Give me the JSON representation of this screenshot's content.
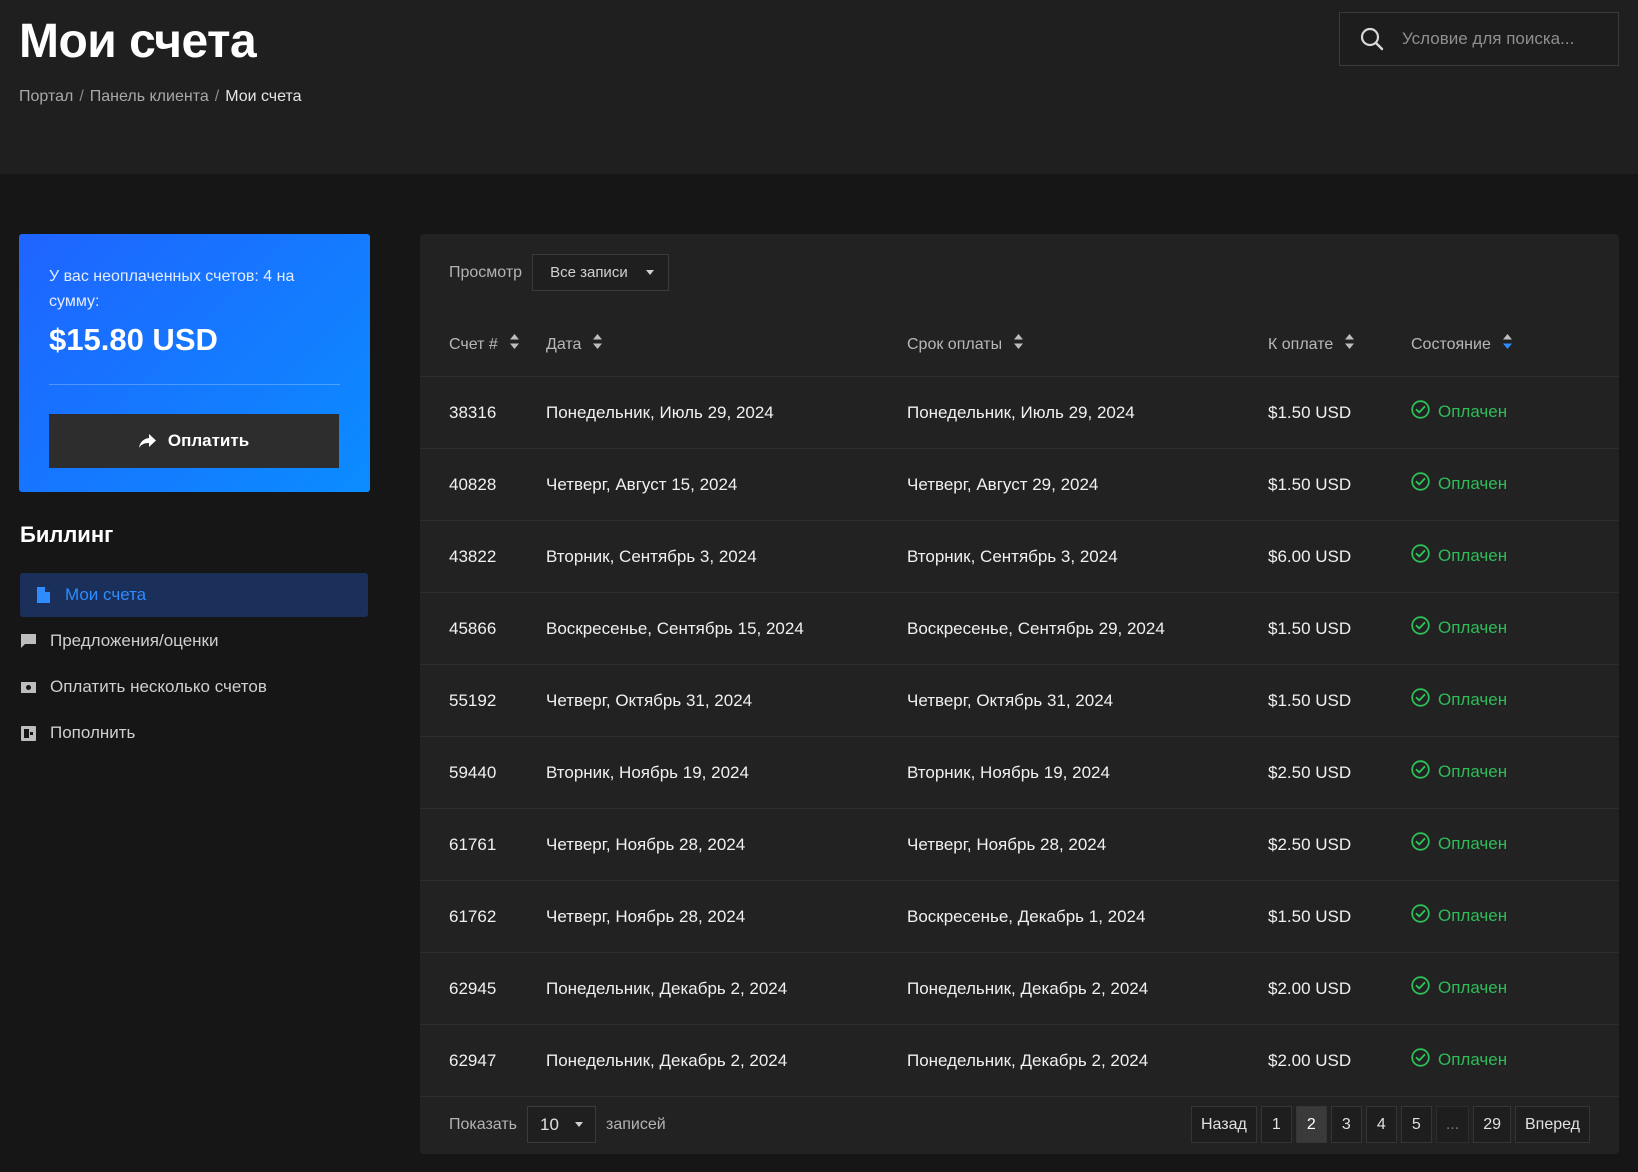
{
  "header": {
    "title": "Мои счета",
    "breadcrumb": [
      "Портал",
      "Панель клиента",
      "Мои счета"
    ],
    "search_placeholder": "Условие для поиска..."
  },
  "balance": {
    "text": "У вас неоплаченных счетов: 4 на сумму:",
    "amount": "$15.80 USD",
    "pay_label": "Оплатить"
  },
  "sidebar": {
    "title": "Биллинг",
    "items": [
      {
        "label": "Мои счета",
        "icon": "file-icon",
        "active": true
      },
      {
        "label": "Предложения/оценки",
        "icon": "comment-icon",
        "active": false
      },
      {
        "label": "Оплатить несколько счетов",
        "icon": "money-icon",
        "active": false
      },
      {
        "label": "Пополнить",
        "icon": "wallet-icon",
        "active": false
      }
    ]
  },
  "table": {
    "view_label": "Просмотр",
    "view_value": "Все записи",
    "columns": [
      "Счет #",
      "Дата",
      "Срок оплаты",
      "К оплате",
      "Состояние"
    ],
    "rows": [
      [
        "38316",
        "Понедельник, Июль 29, 2024",
        "Понедельник, Июль 29, 2024",
        "$1.50 USD",
        "Оплачен"
      ],
      [
        "40828",
        "Четверг, Август 15, 2024",
        "Четверг, Август 29, 2024",
        "$1.50 USD",
        "Оплачен"
      ],
      [
        "43822",
        "Вторник, Сентябрь 3, 2024",
        "Вторник, Сентябрь 3, 2024",
        "$6.00 USD",
        "Оплачен"
      ],
      [
        "45866",
        "Воскресенье, Сентябрь 15, 2024",
        "Воскресенье, Сентябрь 29, 2024",
        "$1.50 USD",
        "Оплачен"
      ],
      [
        "55192",
        "Четверг, Октябрь 31, 2024",
        "Четверг, Октябрь 31, 2024",
        "$1.50 USD",
        "Оплачен"
      ],
      [
        "59440",
        "Вторник, Ноябрь 19, 2024",
        "Вторник, Ноябрь 19, 2024",
        "$2.50 USD",
        "Оплачен"
      ],
      [
        "61761",
        "Четверг, Ноябрь 28, 2024",
        "Четверг, Ноябрь 28, 2024",
        "$2.50 USD",
        "Оплачен"
      ],
      [
        "61762",
        "Четверг, Ноябрь 28, 2024",
        "Воскресенье, Декабрь 1, 2024",
        "$1.50 USD",
        "Оплачен"
      ],
      [
        "62945",
        "Понедельник, Декабрь 2, 2024",
        "Понедельник, Декабрь 2, 2024",
        "$2.00 USD",
        "Оплачен"
      ],
      [
        "62947",
        "Понедельник, Декабрь 2, 2024",
        "Понедельник, Декабрь 2, 2024",
        "$2.00 USD",
        "Оплачен"
      ]
    ],
    "status_color": "#2ebd59"
  },
  "footer": {
    "show_label": "Показать",
    "page_size": "10",
    "records_label": "записей",
    "prev_label": "Назад",
    "next_label": "Вперед",
    "pages": [
      "1",
      "2",
      "3",
      "4",
      "5",
      "...",
      "29"
    ],
    "current_page": "2"
  },
  "colors": {
    "accent": "#1f64ff",
    "active_menu_bg": "#1a2f5a",
    "active_menu_text": "#2d8cff"
  }
}
